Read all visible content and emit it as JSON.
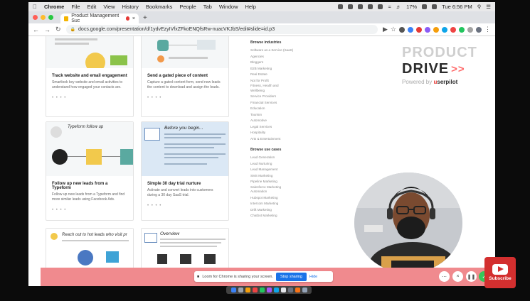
{
  "menubar": {
    "app": "Chrome",
    "items": [
      "File",
      "Edit",
      "View",
      "History",
      "Bookmarks",
      "People",
      "Tab",
      "Window",
      "Help"
    ],
    "battery": "17%",
    "clock": "Tue 6:56 PM"
  },
  "browser": {
    "tab_title": "Product Management Suc",
    "new_tab_symbol": "+",
    "url": "docs.google.com/presentation/d/1ydvEzyIVfxZFkoENQfsRw-nuacVKJbS/edit#slide=id.p3",
    "colors": {
      "close": "#ff5f57",
      "min": "#febc2e",
      "max": "#28c840"
    }
  },
  "cards": [
    {
      "title": "Track website and email engagement",
      "desc": "Smartlook key website and email activities to understand how engaged your contacts are.",
      "dots": "• • • •"
    },
    {
      "title": "Send a gated piece of content",
      "desc": "Capture a gated content form, send new leads the content to download and assign the leads.",
      "dots": "• • • •"
    },
    {
      "img_title": "Typeform follow up",
      "title": "Follow up new leads from a Typeform",
      "desc": "Follow up new leads from a Typeform and find more similar leads using Facebook Ads.",
      "dots": "• • • •"
    },
    {
      "img_title": "Before you begin...",
      "title": "Simple 30 day trial nurture",
      "desc": "Activate and convert leads into customers during a 30 day SaaS trial.",
      "dots": "• • • •"
    },
    {
      "img_title": "Reach out to  hot leads who visit pr"
    },
    {
      "img_title": "Overview"
    }
  ],
  "sidebar": {
    "industries_header": "Browse industries",
    "industries": [
      "Software as a Service (SaaS)",
      "Agencies",
      "Bloggers",
      "B2B Marketing",
      "Real Estate",
      "Not for Profit",
      "Fitness, Health and Wellbeing",
      "Service Providers",
      "Financial Services",
      "Education",
      "Tourism",
      "Automotive",
      "Legal Services",
      "Hospitality",
      "Arts & Entertainment"
    ],
    "usecases_header": "Browse use cases",
    "usecases": [
      "Lead Generation",
      "Lead Nurturing",
      "Lead Management",
      "SMS Marketing",
      "Pipeline Marketing",
      "Salesforce Marketing Automation",
      "Hubspot Marketing",
      "Intercom Marketing",
      "Drift Marketing",
      "Chatbot Marketing"
    ]
  },
  "brand": {
    "line1": "PRODUCT",
    "line2": "DRIVE",
    "arrows": ">>",
    "powered": "Powered by",
    "u": "u",
    "company": "serpilot"
  },
  "loom": {
    "share_text": "Loom for Chrome is sharing your screen.",
    "stop_label": "Stop sharing",
    "hide_label": "Hide"
  },
  "youtube": {
    "label": "Subscribe"
  }
}
